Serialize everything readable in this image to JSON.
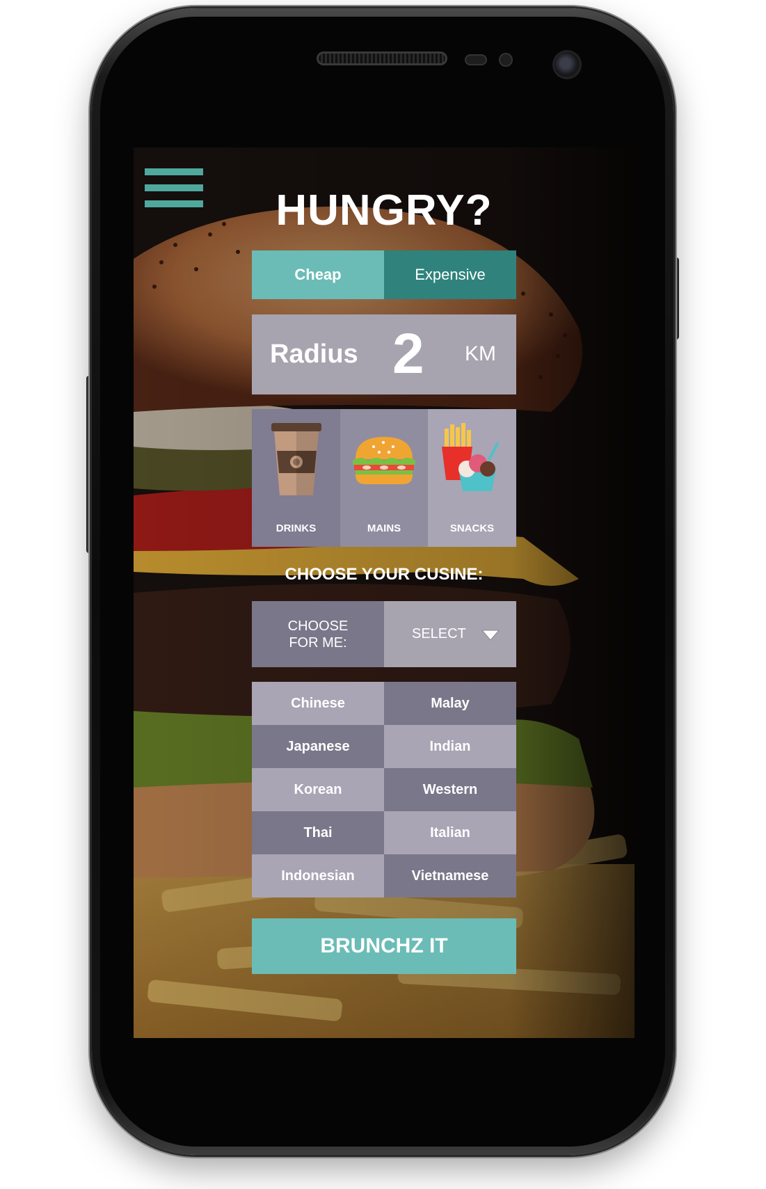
{
  "app": {
    "title": "HUNGRY?"
  },
  "price": {
    "options": [
      "Cheap",
      "Expensive"
    ],
    "selected": "Cheap"
  },
  "radius": {
    "label": "Radius",
    "value": "2",
    "unit": "KM"
  },
  "categories": [
    {
      "label": "DRINKS",
      "icon": "coffee-cup-icon"
    },
    {
      "label": "MAINS",
      "icon": "burger-icon"
    },
    {
      "label": "SNACKS",
      "icon": "fries-icecream-icon"
    }
  ],
  "cuisine": {
    "heading": "CHOOSE YOUR CUSINE:",
    "choose_for_me_line1": "CHOOSE",
    "choose_for_me_line2": "FOR ME:",
    "select_label": "SELECT",
    "options": [
      "Chinese",
      "Malay",
      "Japanese",
      "Indian",
      "Korean",
      "Western",
      "Thai",
      "Italian",
      "Indonesian",
      "Vietnamese"
    ]
  },
  "action": {
    "label": "BRUNCHZ IT"
  },
  "colors": {
    "accent": "#6bbcb6",
    "accent_dark": "#2f837c",
    "tile_light": "#a9a5b4",
    "tile_dark": "#7b778a"
  }
}
